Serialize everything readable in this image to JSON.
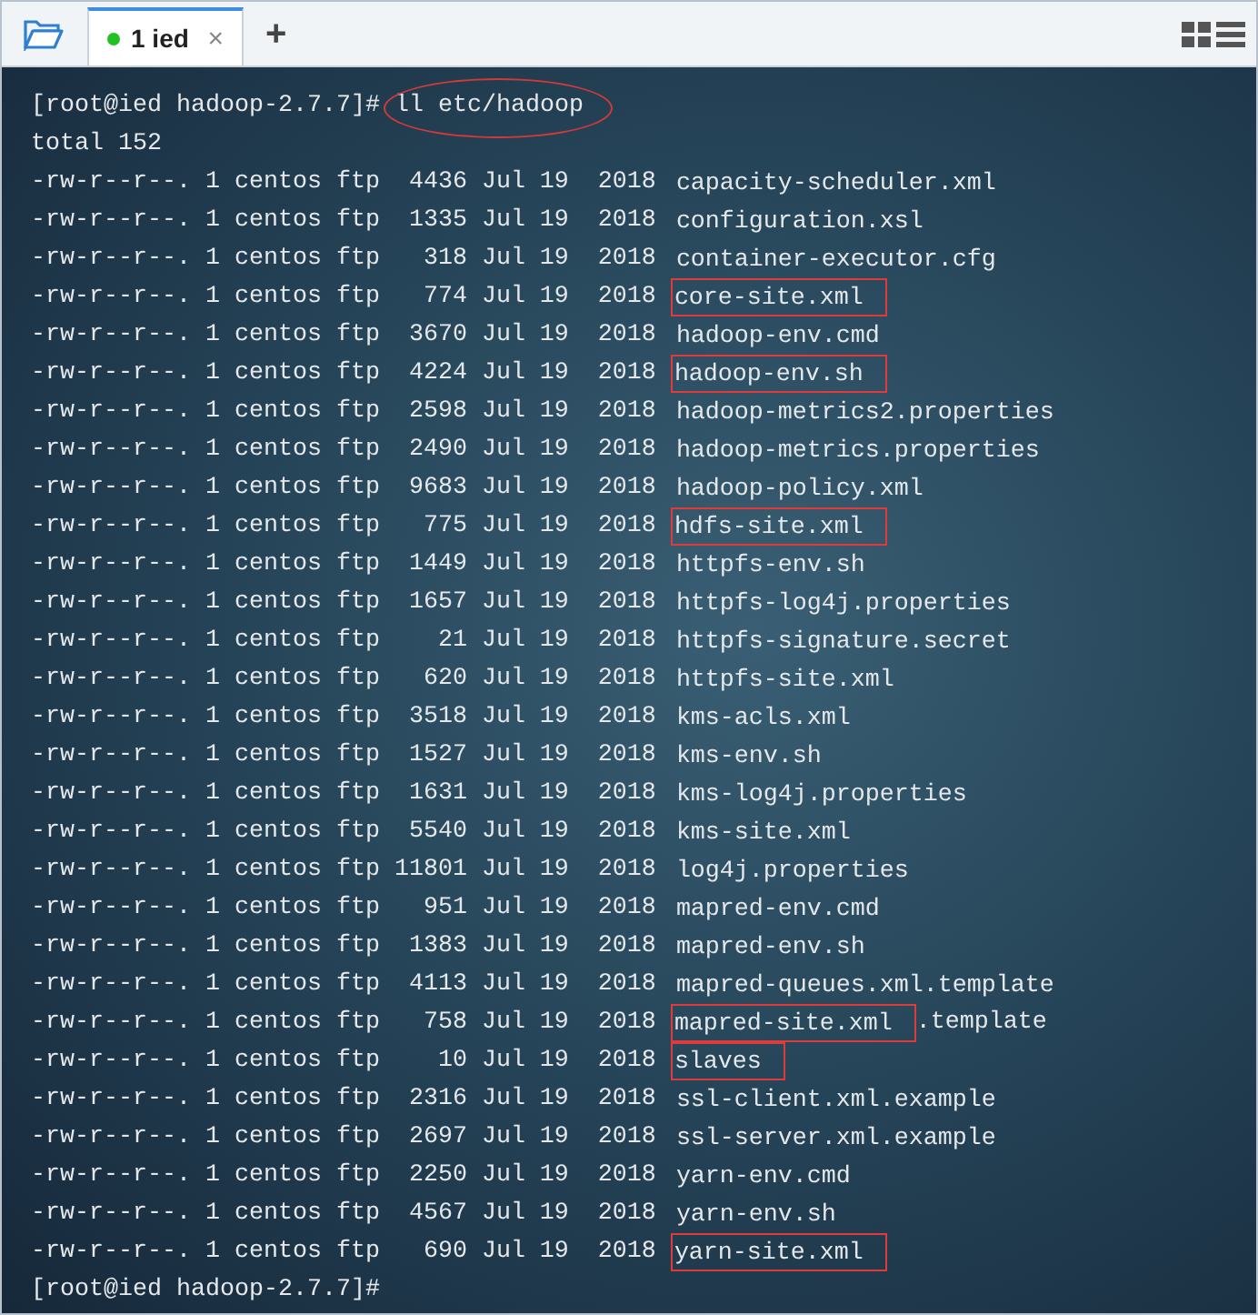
{
  "tabs": [
    {
      "label": "1 ied",
      "selected": true,
      "connected": true,
      "close": "×"
    }
  ],
  "new_tab": "+",
  "terminal": {
    "command_line": {
      "prompt": "[root@ied hadoop-2.7.7]#",
      "command": "ll etc/hadoop",
      "circled": true
    },
    "total": "total 152",
    "files": [
      {
        "info": "-rw-r--r--. 1 centos ftp  4436 Jul 19  2018",
        "name": "capacity-scheduler.xml",
        "boxed": false
      },
      {
        "info": "-rw-r--r--. 1 centos ftp  1335 Jul 19  2018",
        "name": "configuration.xsl",
        "boxed": false
      },
      {
        "info": "-rw-r--r--. 1 centos ftp   318 Jul 19  2018",
        "name": "container-executor.cfg",
        "boxed": false
      },
      {
        "info": "-rw-r--r--. 1 centos ftp   774 Jul 19  2018",
        "name": "core-site.xml",
        "boxed": true
      },
      {
        "info": "-rw-r--r--. 1 centos ftp  3670 Jul 19  2018",
        "name": "hadoop-env.cmd",
        "boxed": false
      },
      {
        "info": "-rw-r--r--. 1 centos ftp  4224 Jul 19  2018",
        "name": "hadoop-env.sh",
        "boxed": true
      },
      {
        "info": "-rw-r--r--. 1 centos ftp  2598 Jul 19  2018",
        "name": "hadoop-metrics2.properties",
        "boxed": false
      },
      {
        "info": "-rw-r--r--. 1 centos ftp  2490 Jul 19  2018",
        "name": "hadoop-metrics.properties",
        "boxed": false
      },
      {
        "info": "-rw-r--r--. 1 centos ftp  9683 Jul 19  2018",
        "name": "hadoop-policy.xml",
        "boxed": false
      },
      {
        "info": "-rw-r--r--. 1 centos ftp   775 Jul 19  2018",
        "name": "hdfs-site.xml",
        "boxed": true
      },
      {
        "info": "-rw-r--r--. 1 centos ftp  1449 Jul 19  2018",
        "name": "httpfs-env.sh",
        "boxed": false
      },
      {
        "info": "-rw-r--r--. 1 centos ftp  1657 Jul 19  2018",
        "name": "httpfs-log4j.properties",
        "boxed": false
      },
      {
        "info": "-rw-r--r--. 1 centos ftp    21 Jul 19  2018",
        "name": "httpfs-signature.secret",
        "boxed": false
      },
      {
        "info": "-rw-r--r--. 1 centos ftp   620 Jul 19  2018",
        "name": "httpfs-site.xml",
        "boxed": false
      },
      {
        "info": "-rw-r--r--. 1 centos ftp  3518 Jul 19  2018",
        "name": "kms-acls.xml",
        "boxed": false
      },
      {
        "info": "-rw-r--r--. 1 centos ftp  1527 Jul 19  2018",
        "name": "kms-env.sh",
        "boxed": false
      },
      {
        "info": "-rw-r--r--. 1 centos ftp  1631 Jul 19  2018",
        "name": "kms-log4j.properties",
        "boxed": false
      },
      {
        "info": "-rw-r--r--. 1 centos ftp  5540 Jul 19  2018",
        "name": "kms-site.xml",
        "boxed": false
      },
      {
        "info": "-rw-r--r--. 1 centos ftp 11801 Jul 19  2018",
        "name": "log4j.properties",
        "boxed": false
      },
      {
        "info": "-rw-r--r--. 1 centos ftp   951 Jul 19  2018",
        "name": "mapred-env.cmd",
        "boxed": false
      },
      {
        "info": "-rw-r--r--. 1 centos ftp  1383 Jul 19  2018",
        "name": "mapred-env.sh",
        "boxed": false
      },
      {
        "info": "-rw-r--r--. 1 centos ftp  4113 Jul 19  2018",
        "name": "mapred-queues.xml.template",
        "boxed": false
      },
      {
        "info": "-rw-r--r--. 1 centos ftp   758 Jul 19  2018",
        "name": "mapred-site.xml",
        "suffix": ".template",
        "boxed": true
      },
      {
        "info": "-rw-r--r--. 1 centos ftp    10 Jul 19  2018",
        "name": "slaves",
        "boxed": true
      },
      {
        "info": "-rw-r--r--. 1 centos ftp  2316 Jul 19  2018",
        "name": "ssl-client.xml.example",
        "boxed": false
      },
      {
        "info": "-rw-r--r--. 1 centos ftp  2697 Jul 19  2018",
        "name": "ssl-server.xml.example",
        "boxed": false
      },
      {
        "info": "-rw-r--r--. 1 centos ftp  2250 Jul 19  2018",
        "name": "yarn-env.cmd",
        "boxed": false
      },
      {
        "info": "-rw-r--r--. 1 centos ftp  4567 Jul 19  2018",
        "name": "yarn-env.sh",
        "boxed": false
      },
      {
        "info": "-rw-r--r--. 1 centos ftp   690 Jul 19  2018",
        "name": "yarn-site.xml",
        "boxed": true
      }
    ],
    "final_prompt": "[root@ied hadoop-2.7.7]#"
  }
}
